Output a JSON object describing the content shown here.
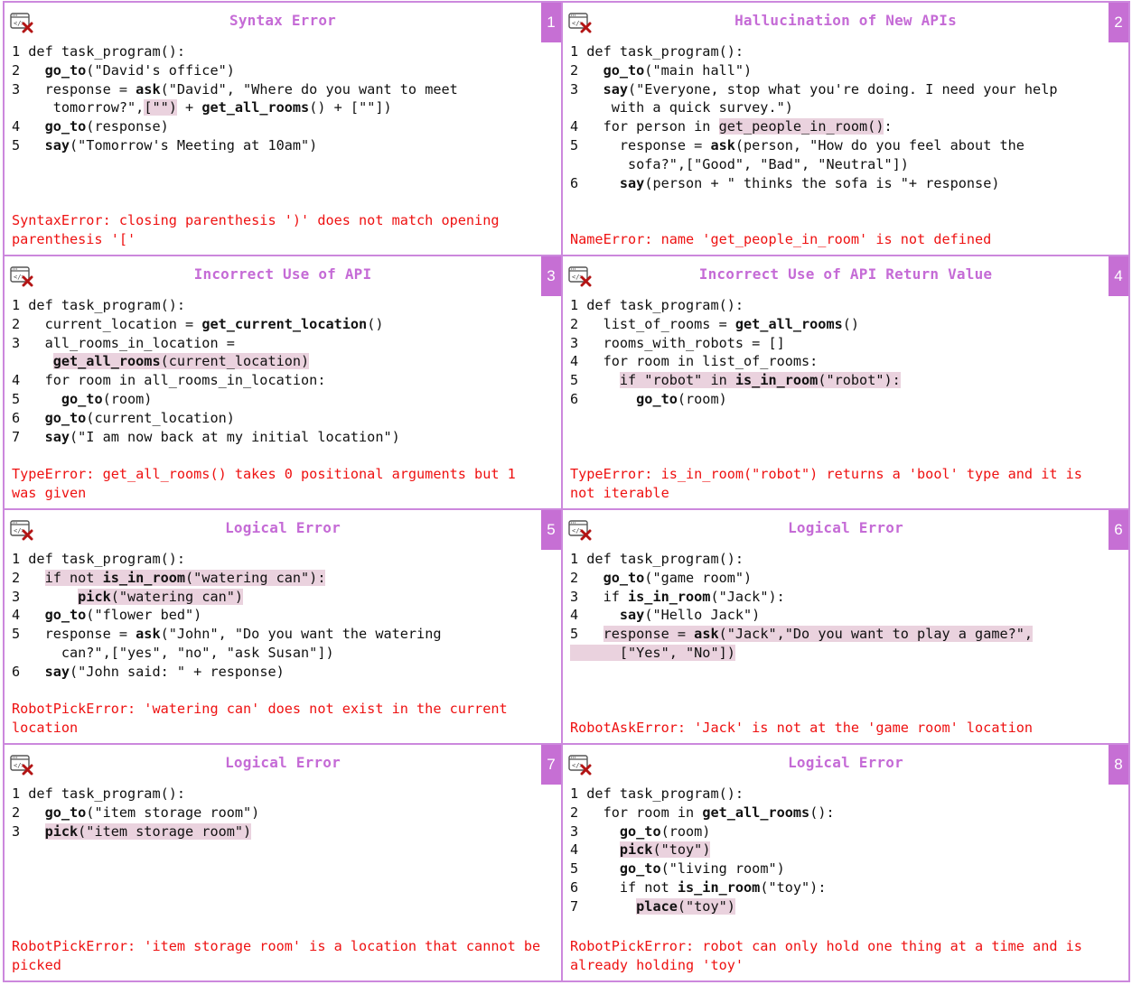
{
  "accent_color": "#c66fd4",
  "error_color": "#ee1111",
  "highlight_color": "#ead2de",
  "panels": [
    {
      "number": "1",
      "title": "Syntax Error",
      "icon": "code-error-icon",
      "lines": [
        {
          "segs": [
            {
              "t": "1 def task_program():"
            }
          ]
        },
        {
          "segs": [
            {
              "t": "2   "
            },
            {
              "t": "go_to",
              "b": true
            },
            {
              "t": "(\"David's office\")"
            }
          ]
        },
        {
          "segs": [
            {
              "t": "3   response = "
            },
            {
              "t": "ask",
              "b": true
            },
            {
              "t": "(\"David\", \"Where do you want to meet"
            }
          ]
        },
        {
          "segs": [
            {
              "t": "     tomorrow?\","
            },
            {
              "t": "[\"\")",
              "h": true
            },
            {
              "t": " + "
            },
            {
              "t": "get_all_rooms",
              "b": true
            },
            {
              "t": "() + [\"\"])"
            }
          ]
        },
        {
          "segs": [
            {
              "t": "4   "
            },
            {
              "t": "go_to",
              "b": true
            },
            {
              "t": "(response)"
            }
          ]
        },
        {
          "segs": [
            {
              "t": "5   "
            },
            {
              "t": "say",
              "b": true
            },
            {
              "t": "(\"Tomorrow's Meeting at 10am\")"
            }
          ]
        }
      ],
      "error": "SyntaxError: closing parenthesis ')' does not match opening parenthesis '['"
    },
    {
      "number": "2",
      "title": "Hallucination of New APIs",
      "icon": "code-error-icon",
      "lines": [
        {
          "segs": [
            {
              "t": "1 def task_program():"
            }
          ]
        },
        {
          "segs": [
            {
              "t": "2   "
            },
            {
              "t": "go_to",
              "b": true
            },
            {
              "t": "(\"main hall\")"
            }
          ]
        },
        {
          "segs": [
            {
              "t": "3   "
            },
            {
              "t": "say",
              "b": true
            },
            {
              "t": "(\"Everyone, stop what you're doing. I need your help"
            }
          ]
        },
        {
          "segs": [
            {
              "t": "     with a quick survey.\")"
            }
          ]
        },
        {
          "segs": [
            {
              "t": "4   for person in "
            },
            {
              "t": "get_people_in_room()",
              "h": true
            },
            {
              "t": ":"
            }
          ]
        },
        {
          "segs": [
            {
              "t": "5     response = "
            },
            {
              "t": "ask",
              "b": true
            },
            {
              "t": "(person, \"How do you feel about the"
            }
          ]
        },
        {
          "segs": [
            {
              "t": "       sofa?\",[\"Good\", \"Bad\", \"Neutral\"])"
            }
          ]
        },
        {
          "segs": [
            {
              "t": "6     "
            },
            {
              "t": "say",
              "b": true
            },
            {
              "t": "(person + \" thinks the sofa is \"+ response)"
            }
          ]
        }
      ],
      "error": "NameError: name 'get_people_in_room' is not defined"
    },
    {
      "number": "3",
      "title": "Incorrect Use of API",
      "icon": "code-error-icon",
      "lines": [
        {
          "segs": [
            {
              "t": "1 def task_program():"
            }
          ]
        },
        {
          "segs": [
            {
              "t": "2   current_location = "
            },
            {
              "t": "get_current_location",
              "b": true
            },
            {
              "t": "()"
            }
          ]
        },
        {
          "segs": [
            {
              "t": "3   all_rooms_in_location ="
            }
          ]
        },
        {
          "segs": [
            {
              "t": "     "
            },
            {
              "t": "get_all_rooms",
              "b": true,
              "h": true
            },
            {
              "t": "(current_location)",
              "h": true
            }
          ]
        },
        {
          "segs": [
            {
              "t": "4   for room in all_rooms_in_location:"
            }
          ]
        },
        {
          "segs": [
            {
              "t": "5     "
            },
            {
              "t": "go_to",
              "b": true
            },
            {
              "t": "(room)"
            }
          ]
        },
        {
          "segs": [
            {
              "t": "6   "
            },
            {
              "t": "go_to",
              "b": true
            },
            {
              "t": "(current_location)"
            }
          ]
        },
        {
          "segs": [
            {
              "t": "7   "
            },
            {
              "t": "say",
              "b": true
            },
            {
              "t": "(\"I am now back at my initial location\")"
            }
          ]
        }
      ],
      "error": "TypeError: get_all_rooms() takes 0 positional arguments but 1 was given"
    },
    {
      "number": "4",
      "title": "Incorrect Use of API Return Value",
      "icon": "code-error-icon",
      "lines": [
        {
          "segs": [
            {
              "t": "1 def task_program():"
            }
          ]
        },
        {
          "segs": [
            {
              "t": "2   list_of_rooms = "
            },
            {
              "t": "get_all_rooms",
              "b": true
            },
            {
              "t": "()"
            }
          ]
        },
        {
          "segs": [
            {
              "t": "3   rooms_with_robots = []"
            }
          ]
        },
        {
          "segs": [
            {
              "t": "4   for room in list_of_rooms:"
            }
          ]
        },
        {
          "segs": [
            {
              "t": "5     "
            },
            {
              "t": "if \"robot\" in ",
              "h": true
            },
            {
              "t": "is_in_room",
              "b": true,
              "h": true
            },
            {
              "t": "(\"robot\"):",
              "h": true
            }
          ]
        },
        {
          "segs": [
            {
              "t": "6       "
            },
            {
              "t": "go_to",
              "b": true
            },
            {
              "t": "(room)"
            }
          ]
        }
      ],
      "error": "TypeError: is_in_room(\"robot\") returns a 'bool' type and it is not iterable"
    },
    {
      "number": "5",
      "title": "Logical Error",
      "icon": "code-error-icon",
      "lines": [
        {
          "segs": [
            {
              "t": "1 def task_program():"
            }
          ]
        },
        {
          "segs": [
            {
              "t": "2   "
            },
            {
              "t": "if not ",
              "h": true
            },
            {
              "t": "is_in_room",
              "b": true,
              "h": true
            },
            {
              "t": "(\"watering can\"):",
              "h": true
            }
          ]
        },
        {
          "segs": [
            {
              "t": "3       "
            },
            {
              "t": "pick",
              "b": true,
              "h": true
            },
            {
              "t": "(\"watering can\")",
              "h": true
            }
          ]
        },
        {
          "segs": [
            {
              "t": "4   "
            },
            {
              "t": "go_to",
              "b": true
            },
            {
              "t": "(\"flower bed\")"
            }
          ]
        },
        {
          "segs": [
            {
              "t": "5   response = "
            },
            {
              "t": "ask",
              "b": true
            },
            {
              "t": "(\"John\", \"Do you want the watering"
            }
          ]
        },
        {
          "segs": [
            {
              "t": "      can?\",[\"yes\", \"no\", \"ask Susan\"])"
            }
          ]
        },
        {
          "segs": [
            {
              "t": "6   "
            },
            {
              "t": "say",
              "b": true
            },
            {
              "t": "(\"John said: \" + response)"
            }
          ]
        }
      ],
      "error": "RobotPickError: 'watering can' does not exist in the current location"
    },
    {
      "number": "6",
      "title": "Logical Error",
      "icon": "code-error-icon",
      "lines": [
        {
          "segs": [
            {
              "t": "1 def task_program():"
            }
          ]
        },
        {
          "segs": [
            {
              "t": "2   "
            },
            {
              "t": "go_to",
              "b": true
            },
            {
              "t": "(\"game room\")"
            }
          ]
        },
        {
          "segs": [
            {
              "t": "3   if "
            },
            {
              "t": "is_in_room",
              "b": true
            },
            {
              "t": "(\"Jack\"):"
            }
          ]
        },
        {
          "segs": [
            {
              "t": "4     "
            },
            {
              "t": "say",
              "b": true
            },
            {
              "t": "(\"Hello Jack\")"
            }
          ]
        },
        {
          "segs": [
            {
              "t": "5   "
            },
            {
              "t": "response = ",
              "h": true
            },
            {
              "t": "ask",
              "b": true,
              "h": true
            },
            {
              "t": "(\"Jack\",\"Do you want to play a game?\",",
              "h": true
            }
          ]
        },
        {
          "segs": [
            {
              "t": "      [\"Yes\", \"No\"])",
              "h": true
            }
          ]
        }
      ],
      "error": "RobotAskError: 'Jack' is not at the 'game room' location"
    },
    {
      "number": "7",
      "title": "Logical Error",
      "icon": "code-error-icon",
      "lines": [
        {
          "segs": [
            {
              "t": "1 def task_program():"
            }
          ]
        },
        {
          "segs": [
            {
              "t": "2   "
            },
            {
              "t": "go_to",
              "b": true
            },
            {
              "t": "(\"item storage room\")"
            }
          ]
        },
        {
          "segs": [
            {
              "t": "3   "
            },
            {
              "t": "pick",
              "b": true,
              "h": true
            },
            {
              "t": "(\"item storage room\")",
              "h": true
            }
          ]
        }
      ],
      "error": "RobotPickError: 'item storage room' is a location that cannot be picked"
    },
    {
      "number": "8",
      "title": "Logical Error",
      "icon": "code-error-icon",
      "lines": [
        {
          "segs": [
            {
              "t": "1 def task_program():"
            }
          ]
        },
        {
          "segs": [
            {
              "t": "2   for room in "
            },
            {
              "t": "get_all_rooms",
              "b": true
            },
            {
              "t": "():"
            }
          ]
        },
        {
          "segs": [
            {
              "t": "3     "
            },
            {
              "t": "go_to",
              "b": true
            },
            {
              "t": "(room)"
            }
          ]
        },
        {
          "segs": [
            {
              "t": "4     "
            },
            {
              "t": "pick",
              "b": true,
              "h": true
            },
            {
              "t": "(\"toy\")",
              "h": true
            }
          ]
        },
        {
          "segs": [
            {
              "t": "5     "
            },
            {
              "t": "go_to",
              "b": true
            },
            {
              "t": "(\"living room\")"
            }
          ]
        },
        {
          "segs": [
            {
              "t": "6     if not "
            },
            {
              "t": "is_in_room",
              "b": true
            },
            {
              "t": "(\"toy\"):"
            }
          ]
        },
        {
          "segs": [
            {
              "t": "7       "
            },
            {
              "t": "place",
              "b": true,
              "h": true
            },
            {
              "t": "(\"toy\")",
              "h": true
            }
          ]
        }
      ],
      "error": "RobotPickError: robot can only hold one thing at a time and is already holding 'toy'"
    }
  ]
}
